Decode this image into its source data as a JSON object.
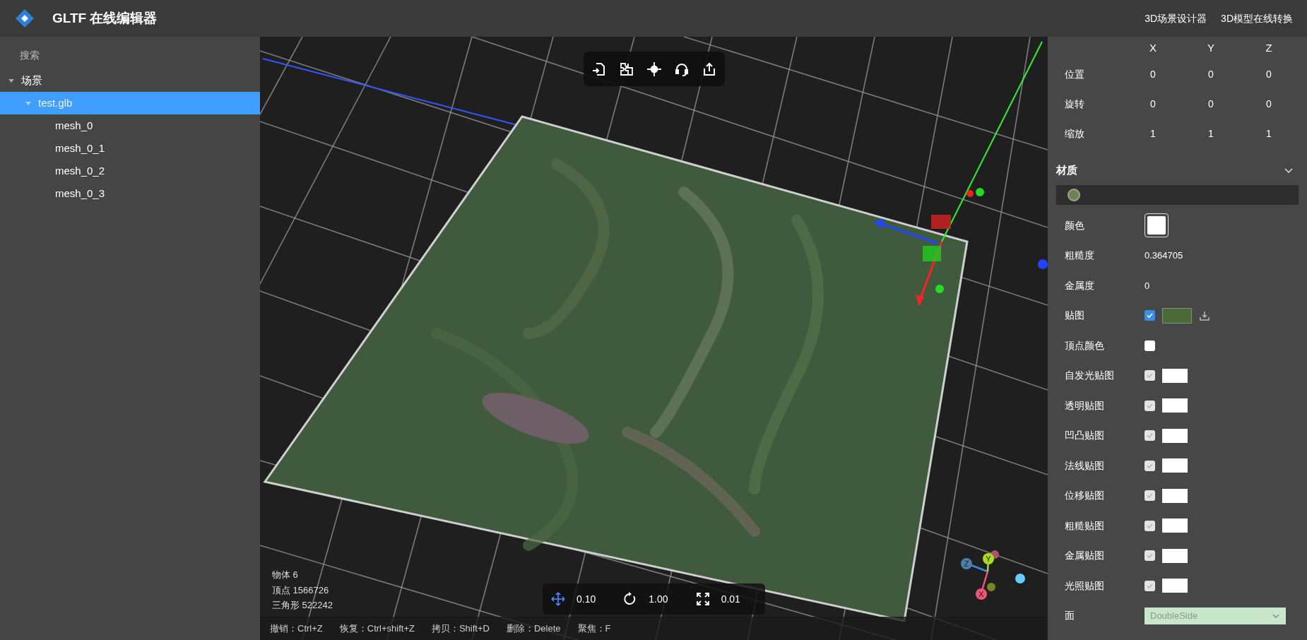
{
  "header": {
    "title": "GLTF 在线编辑器",
    "links": [
      "3D场景设计器",
      "3D模型在线转换"
    ]
  },
  "sidebar": {
    "search": {
      "placeholder": "搜索"
    },
    "tree": [
      {
        "label": "场景",
        "expanded": true,
        "selected": false,
        "children": [
          {
            "label": "test.glb",
            "expanded": true,
            "selected": true,
            "children": [
              {
                "label": "mesh_0",
                "selected": false
              },
              {
                "label": "mesh_0_1",
                "selected": false
              },
              {
                "label": "mesh_0_2",
                "selected": false
              },
              {
                "label": "mesh_0_3",
                "selected": false
              }
            ]
          }
        ]
      }
    ]
  },
  "viewport": {
    "stats": [
      "物体 6",
      "顶点 1566726",
      "三角形 522242"
    ],
    "transform_steps": [
      {
        "kind": "move",
        "value": "0.10"
      },
      {
        "kind": "rotate",
        "value": "1.00"
      },
      {
        "kind": "scale",
        "value": "0.01"
      }
    ],
    "axis_labels": [
      "Z",
      "Y",
      "X"
    ],
    "shortcuts": [
      "撤销：Ctrl+Z",
      "恢复：Ctrl+shift+Z",
      "拷贝：Shift+D",
      "删除：Delete",
      "聚焦：F"
    ]
  },
  "properties": {
    "columns": [
      "X",
      "Y",
      "Z"
    ],
    "rows": [
      {
        "label": "位置",
        "values": [
          "0",
          "0",
          "0"
        ]
      },
      {
        "label": "旋转",
        "values": [
          "0",
          "0",
          "0"
        ]
      },
      {
        "label": "缩放",
        "values": [
          "1",
          "1",
          "1"
        ]
      }
    ],
    "material": {
      "title": "材质",
      "expanded": true,
      "fields": [
        {
          "kind": "color",
          "label": "颜色"
        },
        {
          "kind": "number",
          "label": "粗糙度",
          "value": "0.364705"
        },
        {
          "kind": "number",
          "label": "金属度",
          "value": "0"
        },
        {
          "kind": "map",
          "label": "贴图",
          "checked": true,
          "disabled": false,
          "has_texture": true
        },
        {
          "kind": "checkbox",
          "label": "顶点颜色",
          "checked": false
        },
        {
          "kind": "map",
          "label": "自发光贴图",
          "checked": true,
          "disabled": true,
          "has_texture": false
        },
        {
          "kind": "map",
          "label": "透明贴图",
          "checked": true,
          "disabled": true,
          "has_texture": false
        },
        {
          "kind": "map",
          "label": "凹凸贴图",
          "checked": true,
          "disabled": true,
          "has_texture": false
        },
        {
          "kind": "map",
          "label": "法线贴图",
          "checked": true,
          "disabled": true,
          "has_texture": false
        },
        {
          "kind": "map",
          "label": "位移贴图",
          "checked": true,
          "disabled": true,
          "has_texture": false
        },
        {
          "kind": "map",
          "label": "粗糙贴图",
          "checked": true,
          "disabled": true,
          "has_texture": false
        },
        {
          "kind": "map",
          "label": "金属贴图",
          "checked": true,
          "disabled": true,
          "has_texture": false
        },
        {
          "kind": "map",
          "label": "光照贴图",
          "checked": true,
          "disabled": true,
          "has_texture": false
        },
        {
          "kind": "select",
          "label": "面",
          "value": "DoubleSide",
          "disabled": true
        }
      ]
    }
  }
}
